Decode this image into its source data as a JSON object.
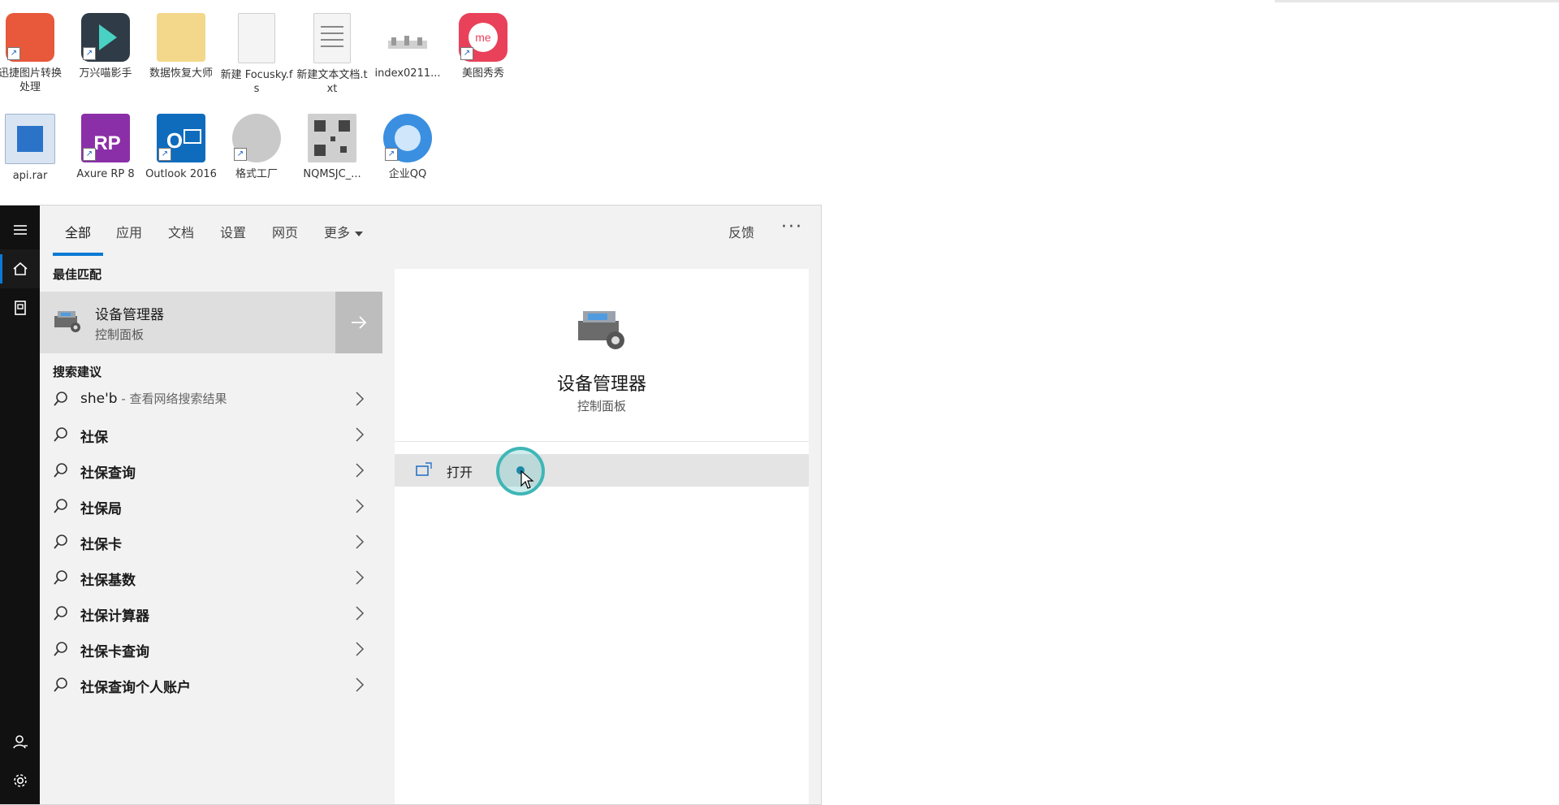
{
  "desktop": {
    "icons": [
      {
        "label": "迅捷图片转换处理",
        "color": "#e8583b",
        "glyph": "🖼"
      },
      {
        "label": "万兴喵影手",
        "color": "#2f3b46",
        "glyph": "◆"
      },
      {
        "label": "数据恢复大师",
        "color": "#f3d78a",
        "glyph": "📁"
      },
      {
        "label": "新建 Focusky.fs",
        "color": "#f4f4f4",
        "glyph": ""
      },
      {
        "label": "新建文本文档.txt",
        "color": "#f4f4f4",
        "glyph": "≡"
      },
      {
        "label": "index0211...",
        "color": "#ffffff",
        "glyph": "▪▪▪"
      },
      {
        "label": "美图秀秀",
        "color": "#e9415a",
        "glyph": "me"
      },
      {
        "label": "api.rar",
        "color": "#d9e4f3",
        "glyph": "▮"
      },
      {
        "label": "Axure RP 8",
        "color": "#8b2fa8",
        "glyph": "RP"
      },
      {
        "label": "Outlook 2016",
        "color": "#0f6cbd",
        "glyph": "O"
      },
      {
        "label": "格式工厂",
        "color": "#c9c9c9",
        "glyph": "⚙"
      },
      {
        "label": "NQMSJC_...",
        "color": "#cfcfcf",
        "glyph": "▦"
      },
      {
        "label": "企业QQ",
        "color": "#3a8fe0",
        "glyph": "Q"
      }
    ]
  },
  "rail": {
    "menu_icon": "hamburger-icon",
    "home_icon": "home-icon",
    "doc_icon": "document-icon",
    "user_icon": "user-icon",
    "settings_icon": "gear-icon"
  },
  "tabs": {
    "all": "全部",
    "apps": "应用",
    "docs": "文档",
    "settings": "设置",
    "web": "网页",
    "more": "更多",
    "feedback": "反馈",
    "dots": "···"
  },
  "best_match": {
    "heading": "最佳匹配",
    "name": "设备管理器",
    "sub": "控制面板"
  },
  "suggestions": {
    "heading": "搜索建议",
    "first_query": "she'b",
    "first_hint": " - 查看网络搜索结果",
    "items": [
      "社保",
      "社保查询",
      "社保局",
      "社保卡",
      "社保基数",
      "社保计算器",
      "社保卡查询",
      "社保查询个人账户"
    ]
  },
  "preview": {
    "title": "设备管理器",
    "sub": "控制面板",
    "open_label": "打开"
  },
  "colors": {
    "accent": "#0a7ad4",
    "rail_bg": "#111111",
    "ripple": "#3fb6b6"
  }
}
